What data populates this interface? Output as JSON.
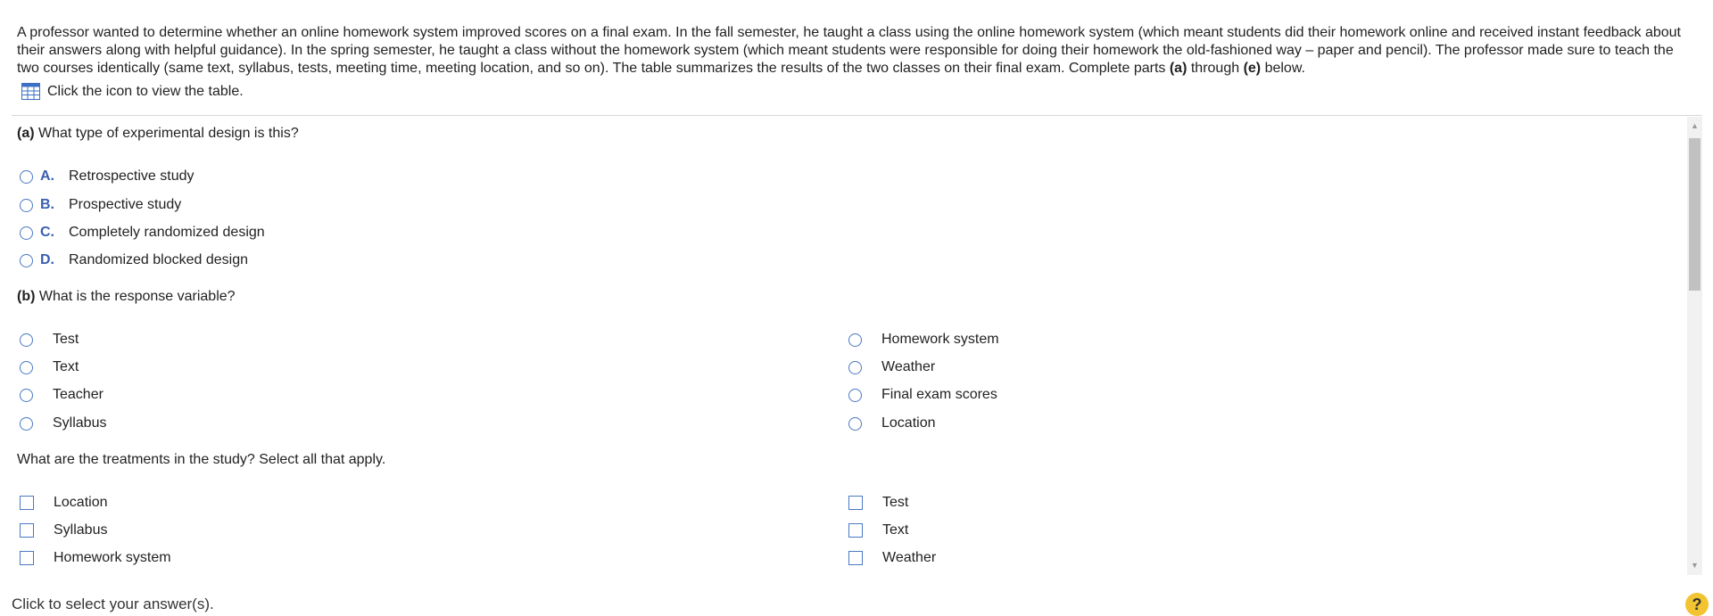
{
  "intro": {
    "text1": "A professor wanted to determine whether an online homework system improved scores on a final exam. In the fall semester, he taught a class using the online homework system (which meant students did their homework online and received instant feedback about their answers along with helpful guidance). In the spring semester, he taught a class without the homework system (which meant students were responsible for doing their homework the old-fashioned way – paper and pencil). The professor made sure to teach the two courses identically (same text, syllabus, tests, meeting time, meeting location, and so on). The table summarizes the results of the two classes on their final exam. Complete parts ",
    "part_a": "(a)",
    "through": " through ",
    "part_e": "(e)",
    "below": " below."
  },
  "table_link": {
    "label": "Click the icon to view the table.",
    "icon": "table-grid-icon"
  },
  "part_a": {
    "tag": "(a)",
    "question": " What type of experimental design is this?",
    "options": [
      {
        "letter": "A.",
        "label": "Retrospective study"
      },
      {
        "letter": "B.",
        "label": "Prospective study"
      },
      {
        "letter": "C.",
        "label": "Completely randomized design"
      },
      {
        "letter": "D.",
        "label": "Randomized blocked design"
      }
    ]
  },
  "part_b": {
    "tag": "(b)",
    "question": " What is the response variable?",
    "left_options": [
      "Test",
      "Text",
      "Teacher",
      "Syllabus"
    ],
    "right_options": [
      "Homework system",
      "Weather",
      "Final exam scores",
      "Location"
    ]
  },
  "treatments": {
    "question": "What are the treatments in the study? Select all that apply.",
    "left_options": [
      "Location",
      "Syllabus",
      "Homework system"
    ],
    "right_options": [
      "Test",
      "Text",
      "Weather"
    ]
  },
  "footer": {
    "status": "Click to select your answer(s).",
    "help": "?"
  },
  "colors": {
    "accent": "#4a78c2",
    "letter": "#3a5fb0",
    "help_bg": "#f2c432"
  }
}
